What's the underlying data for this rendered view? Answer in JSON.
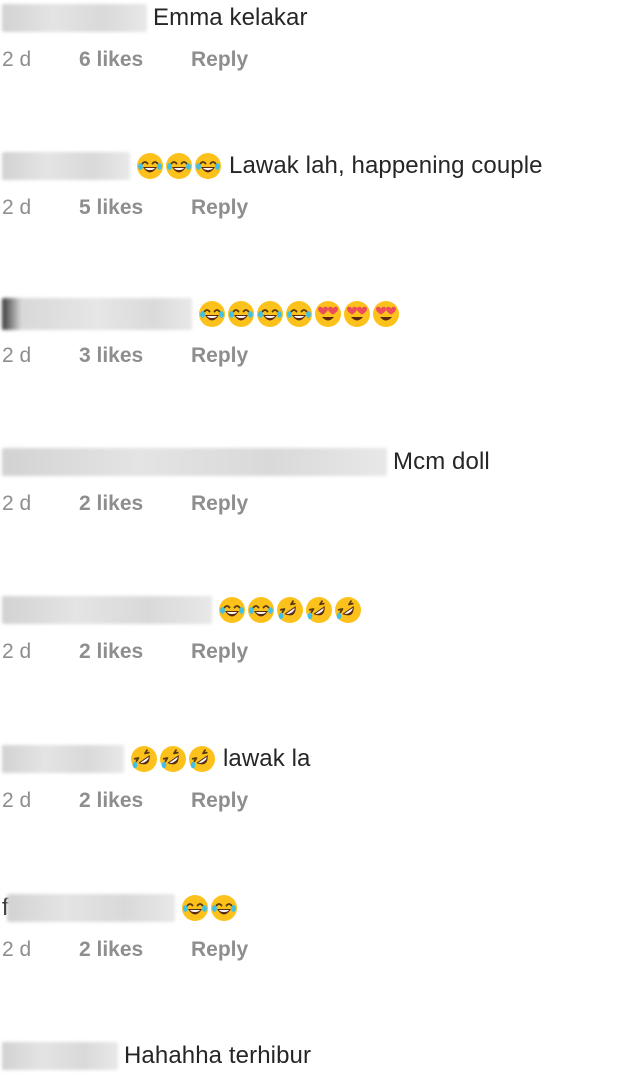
{
  "comments": [
    {
      "text": "Emma kelakar",
      "time": "2 d",
      "likes": "6 likes",
      "reply": "Reply",
      "emojis": []
    },
    {
      "text": "Lawak lah, happening couple",
      "time": "2 d",
      "likes": "5 likes",
      "reply": "Reply",
      "emojis": [
        "joy",
        "joy",
        "joy"
      ]
    },
    {
      "text": "",
      "time": "2 d",
      "likes": "3 likes",
      "reply": "Reply",
      "emojis": [
        "joy",
        "joy",
        "joy",
        "joy",
        "heart-eyes",
        "heart-eyes",
        "heart-eyes"
      ]
    },
    {
      "text": "Mcm doll",
      "time": "2 d",
      "likes": "2 likes",
      "reply": "Reply",
      "emojis": []
    },
    {
      "text": "",
      "time": "2 d",
      "likes": "2 likes",
      "reply": "Reply",
      "emojis": [
        "joy",
        "joy",
        "rofl",
        "rofl",
        "rofl"
      ]
    },
    {
      "text": "lawak la",
      "time": "2 d",
      "likes": "2 likes",
      "reply": "Reply",
      "emojis": [
        "rofl",
        "rofl",
        "rofl"
      ]
    },
    {
      "text": "",
      "time": "2 d",
      "likes": "2 likes",
      "reply": "Reply",
      "emojis": [
        "joy",
        "joy"
      ],
      "user_prefix": "f"
    },
    {
      "text": "Hahahha terhibur",
      "time": "",
      "likes": "",
      "reply": "",
      "emojis": []
    }
  ],
  "colors": {
    "text": "#262626",
    "meta": "#8e8e8e",
    "emoji_face": "#fcc21b",
    "emoji_tear": "#40c0e7",
    "emoji_heart": "#ed4c5c"
  }
}
